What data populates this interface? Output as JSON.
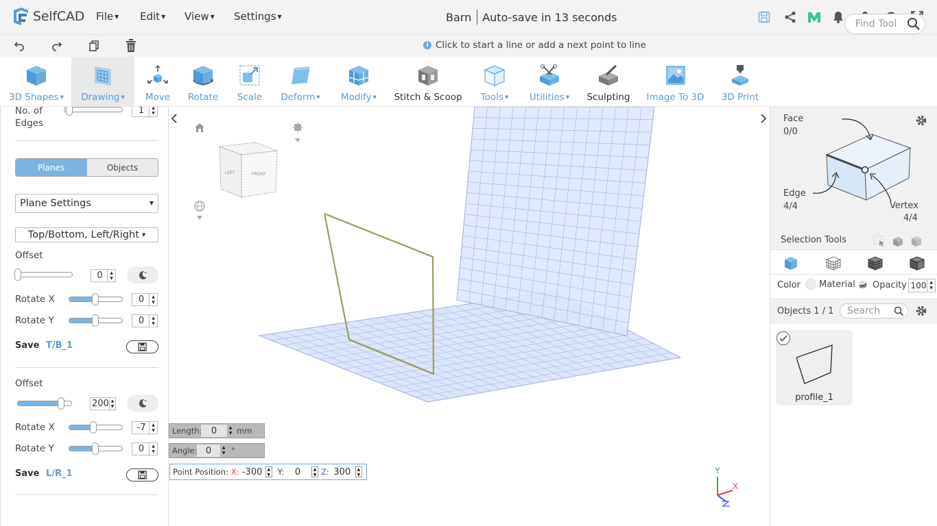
{
  "app": {
    "logo_text": "SelfCAD",
    "menus": [
      "File",
      "Edit",
      "View",
      "Settings"
    ],
    "doc_name": "Barn",
    "autosave": "Auto-save in 13 seconds"
  },
  "hint": "Click to start a line or add a next point to line",
  "toolbar": {
    "tools": [
      {
        "label": "3D Shapes",
        "dropdown": true,
        "icon": "cube-icon"
      },
      {
        "label": "Drawing",
        "dropdown": true,
        "icon": "drawing-icon",
        "active": true
      },
      {
        "label": "Move",
        "dropdown": false,
        "icon": "move-icon"
      },
      {
        "label": "Rotate",
        "dropdown": false,
        "icon": "rotate-icon"
      },
      {
        "label": "Scale",
        "dropdown": false,
        "icon": "scale-icon"
      },
      {
        "label": "Deform",
        "dropdown": true,
        "icon": "deform-icon"
      },
      {
        "label": "Modify",
        "dropdown": true,
        "icon": "modify-icon"
      },
      {
        "label": "Stitch & Scoop",
        "dropdown": false,
        "icon": "stitch-scoop-icon"
      },
      {
        "label": "Tools",
        "dropdown": true,
        "icon": "tools-icon"
      },
      {
        "label": "Utilities",
        "dropdown": true,
        "icon": "utilities-icon"
      },
      {
        "label": "Sculpting",
        "dropdown": false,
        "icon": "sculpting-icon"
      },
      {
        "label": "Image To 3D",
        "dropdown": false,
        "icon": "image-to-3d-icon"
      },
      {
        "label": "3D Print",
        "dropdown": false,
        "icon": "3d-print-icon"
      }
    ],
    "find_placeholder": "Find Tool"
  },
  "left_panel": {
    "edges_label_1": "No. of",
    "edges_label_2": "Edges",
    "edges_value": "1",
    "tab_planes": "Planes",
    "tab_objects": "Objects",
    "plane_settings": "Plane Settings",
    "plane_pair": "Top/Bottom, Left/Right",
    "tb": {
      "offset_label": "Offset",
      "offset": "0",
      "rotate_x_label": "Rotate X",
      "rotate_x": "0",
      "rotate_y_label": "Rotate Y",
      "rotate_y": "0",
      "save_label": "Save",
      "save_name": "T/B_1"
    },
    "lr": {
      "offset_label": "Offset",
      "offset": "200",
      "rotate_x_label": "Rotate X",
      "rotate_x": "-7",
      "rotate_y_label": "Rotate Y",
      "rotate_y": "0",
      "save_label": "Save",
      "save_name": "L/R_1"
    }
  },
  "viewport": {
    "cube_left": "LEFT",
    "cube_front": "FRONT",
    "length_label": "Length:",
    "length": "0",
    "length_unit": "mm",
    "angle_label": "Angle:",
    "angle": "0",
    "angle_unit": "°",
    "point_label": "Point Position:",
    "x_label": "X:",
    "x": "-300",
    "y_label": "Y:",
    "y": "0",
    "z_label": "Z:",
    "z": "300",
    "axis_y": "Y",
    "axis_x": "X"
  },
  "right_panel": {
    "face_label": "Face",
    "face_count": "0/0",
    "edge_label": "Edge",
    "edge_count": "4/4",
    "vertex_label": "Vertex",
    "vertex_count": "4/4",
    "selection_tools": "Selection Tools",
    "color_label": "Color",
    "material_label": "Material",
    "opacity_label": "Opacity",
    "opacity": "100",
    "objects_label": "Objects 1 / 1",
    "search_placeholder": "Search",
    "object_name": "profile_1"
  },
  "colors": {
    "accent": "#5b9bd5",
    "panel_bg": "#f3f3f3",
    "profile_line": "#a09a55",
    "plane_fill": "#dce6fb"
  }
}
